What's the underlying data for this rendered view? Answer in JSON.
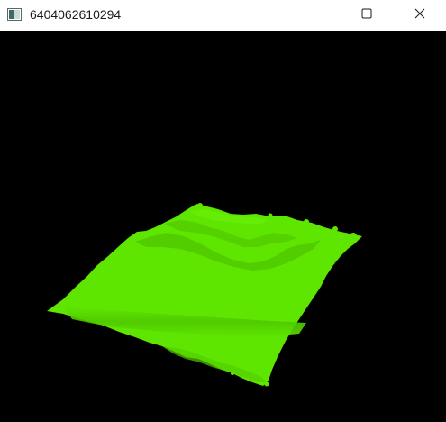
{
  "window": {
    "title": "6404062610294",
    "icon": "app-window-icon",
    "controls": {
      "minimize_icon": "minimize-icon",
      "maximize_icon": "maximize-icon",
      "close_icon": "close-icon"
    }
  },
  "scene": {
    "background_color": "#000000",
    "terrain_color": "#5ee600",
    "terrain_shadow_color": "#4cc400",
    "terrain_highlight_color": "#6ef20a"
  }
}
